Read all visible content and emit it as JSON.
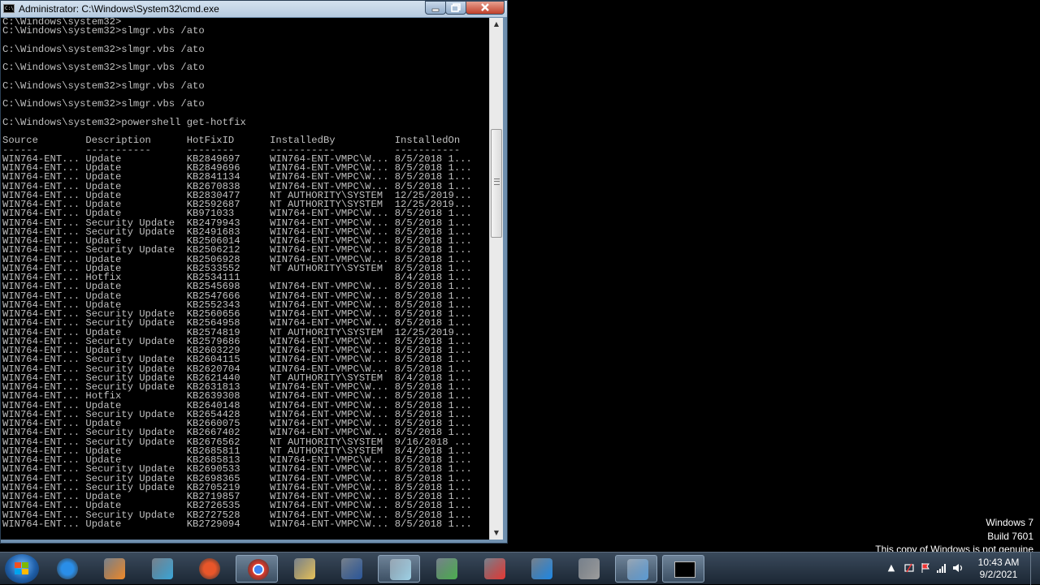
{
  "window": {
    "title": "Administrator: C:\\Windows\\System32\\cmd.exe",
    "icon_text": "C:\\",
    "buttons": {
      "minimize": "minimize-icon",
      "maximize": "maximize-icon",
      "close": "close-icon"
    }
  },
  "console": {
    "lines": [
      "C:\\Windows\\system32>",
      "C:\\Windows\\system32>slmgr.vbs /ato",
      "",
      "C:\\Windows\\system32>slmgr.vbs /ato",
      "",
      "C:\\Windows\\system32>slmgr.vbs /ato",
      "",
      "C:\\Windows\\system32>slmgr.vbs /ato",
      "",
      "C:\\Windows\\system32>slmgr.vbs /ato",
      "",
      "C:\\Windows\\system32>powershell get-hotfix",
      "",
      "Source        Description      HotFixID      InstalledBy          InstalledOn",
      "------        -----------      --------      -----------          -----------",
      "WIN764-ENT... Update           KB2849697     WIN764-ENT-VMPC\\W... 8/5/2018 1...",
      "WIN764-ENT... Update           KB2849696     WIN764-ENT-VMPC\\W... 8/5/2018 1...",
      "WIN764-ENT... Update           KB2841134     WIN764-ENT-VMPC\\W... 8/5/2018 1...",
      "WIN764-ENT... Update           KB2670838     WIN764-ENT-VMPC\\W... 8/5/2018 1...",
      "WIN764-ENT... Update           KB2830477     NT AUTHORITY\\SYSTEM  12/25/2019...",
      "WIN764-ENT... Update           KB2592687     NT AUTHORITY\\SYSTEM  12/25/2019...",
      "WIN764-ENT... Update           KB971033      WIN764-ENT-VMPC\\W... 8/5/2018 1...",
      "WIN764-ENT... Security Update  KB2479943     WIN764-ENT-VMPC\\W... 8/5/2018 1...",
      "WIN764-ENT... Security Update  KB2491683     WIN764-ENT-VMPC\\W... 8/5/2018 1...",
      "WIN764-ENT... Update           KB2506014     WIN764-ENT-VMPC\\W... 8/5/2018 1...",
      "WIN764-ENT... Security Update  KB2506212     WIN764-ENT-VMPC\\W... 8/5/2018 1...",
      "WIN764-ENT... Update           KB2506928     WIN764-ENT-VMPC\\W... 8/5/2018 1...",
      "WIN764-ENT... Update           KB2533552     NT AUTHORITY\\SYSTEM  8/5/2018 1...",
      "WIN764-ENT... Hotfix           KB2534111                          8/4/2018 1...",
      "WIN764-ENT... Update           KB2545698     WIN764-ENT-VMPC\\W... 8/5/2018 1...",
      "WIN764-ENT... Update           KB2547666     WIN764-ENT-VMPC\\W... 8/5/2018 1...",
      "WIN764-ENT... Update           KB2552343     WIN764-ENT-VMPC\\W... 8/5/2018 1...",
      "WIN764-ENT... Security Update  KB2560656     WIN764-ENT-VMPC\\W... 8/5/2018 1...",
      "WIN764-ENT... Security Update  KB2564958     WIN764-ENT-VMPC\\W... 8/5/2018 1...",
      "WIN764-ENT... Update           KB2574819     NT AUTHORITY\\SYSTEM  12/25/2019...",
      "WIN764-ENT... Security Update  KB2579686     WIN764-ENT-VMPC\\W... 8/5/2018 1...",
      "WIN764-ENT... Update           KB2603229     WIN764-ENT-VMPC\\W... 8/5/2018 1...",
      "WIN764-ENT... Security Update  KB2604115     WIN764-ENT-VMPC\\W... 8/5/2018 1...",
      "WIN764-ENT... Security Update  KB2620704     WIN764-ENT-VMPC\\W... 8/5/2018 1...",
      "WIN764-ENT... Security Update  KB2621440     NT AUTHORITY\\SYSTEM  8/4/2018 1...",
      "WIN764-ENT... Security Update  KB2631813     WIN764-ENT-VMPC\\W... 8/5/2018 1...",
      "WIN764-ENT... Hotfix           KB2639308     WIN764-ENT-VMPC\\W... 8/5/2018 1...",
      "WIN764-ENT... Update           KB2640148     WIN764-ENT-VMPC\\W... 8/5/2018 1...",
      "WIN764-ENT... Security Update  KB2654428     WIN764-ENT-VMPC\\W... 8/5/2018 1...",
      "WIN764-ENT... Update           KB2660075     WIN764-ENT-VMPC\\W... 8/5/2018 1...",
      "WIN764-ENT... Security Update  KB2667402     WIN764-ENT-VMPC\\W... 8/5/2018 1...",
      "WIN764-ENT... Security Update  KB2676562     NT AUTHORITY\\SYSTEM  9/16/2018 ...",
      "WIN764-ENT... Update           KB2685811     NT AUTHORITY\\SYSTEM  8/4/2018 1...",
      "WIN764-ENT... Update           KB2685813     WIN764-ENT-VMPC\\W... 8/5/2018 1...",
      "WIN764-ENT... Security Update  KB2690533     WIN764-ENT-VMPC\\W... 8/5/2018 1...",
      "WIN764-ENT... Security Update  KB2698365     WIN764-ENT-VMPC\\W... 8/5/2018 1...",
      "WIN764-ENT... Security Update  KB2705219     WIN764-ENT-VMPC\\W... 8/5/2018 1...",
      "WIN764-ENT... Update           KB2719857     WIN764-ENT-VMPC\\W... 8/5/2018 1...",
      "WIN764-ENT... Update           KB2726535     WIN764-ENT-VMPC\\W... 8/5/2018 1...",
      "WIN764-ENT... Security Update  KB2727528     WIN764-ENT-VMPC\\W... 8/5/2018 1...",
      "WIN764-ENT... Update           KB2729094     WIN764-ENT-VMPC\\W... 8/5/2018 1..."
    ]
  },
  "watermark": {
    "line1": "Windows 7",
    "line2": "Build 7601",
    "line3": "This copy of Windows is not genuine"
  },
  "taskbar": {
    "start_icon": "windows-logo-icon",
    "apps": [
      {
        "name": "internet-explorer-icon",
        "color": "#2a8ee8"
      },
      {
        "name": "media-player-icon",
        "color": "#f08a2a"
      },
      {
        "name": "puzzle-app-icon",
        "color": "#3aa6d9"
      },
      {
        "name": "firefox-icon",
        "color": "#e8562a"
      },
      {
        "name": "chrome-icon",
        "color": "#dd3b2e"
      },
      {
        "name": "file-explorer-icon",
        "color": "#e8c35a"
      },
      {
        "name": "word-icon",
        "color": "#2b579a"
      },
      {
        "name": "glass-app-icon",
        "color": "#9fd3e8"
      },
      {
        "name": "chart-app-icon",
        "color": "#4caf50"
      },
      {
        "name": "pdf-app-icon",
        "color": "#e53935"
      },
      {
        "name": "outlook-app-icon",
        "color": "#1e88e5"
      },
      {
        "name": "tools-app-icon",
        "color": "#9e9e9e"
      },
      {
        "name": "remote-desktop-icon",
        "color": "#5b9bd5"
      },
      {
        "name": "cmd-icon",
        "color": "#000000"
      }
    ],
    "clock_time": "10:43 AM",
    "clock_date": "9/2/2021",
    "tray_icons": [
      "show-hidden-icons-icon",
      "action-center-icon",
      "flag-icon",
      "network-icon",
      "volume-icon"
    ]
  },
  "colors": {
    "console_text": "#c0c0c0",
    "console_bg": "#000000",
    "close_button": "#c0402a"
  }
}
